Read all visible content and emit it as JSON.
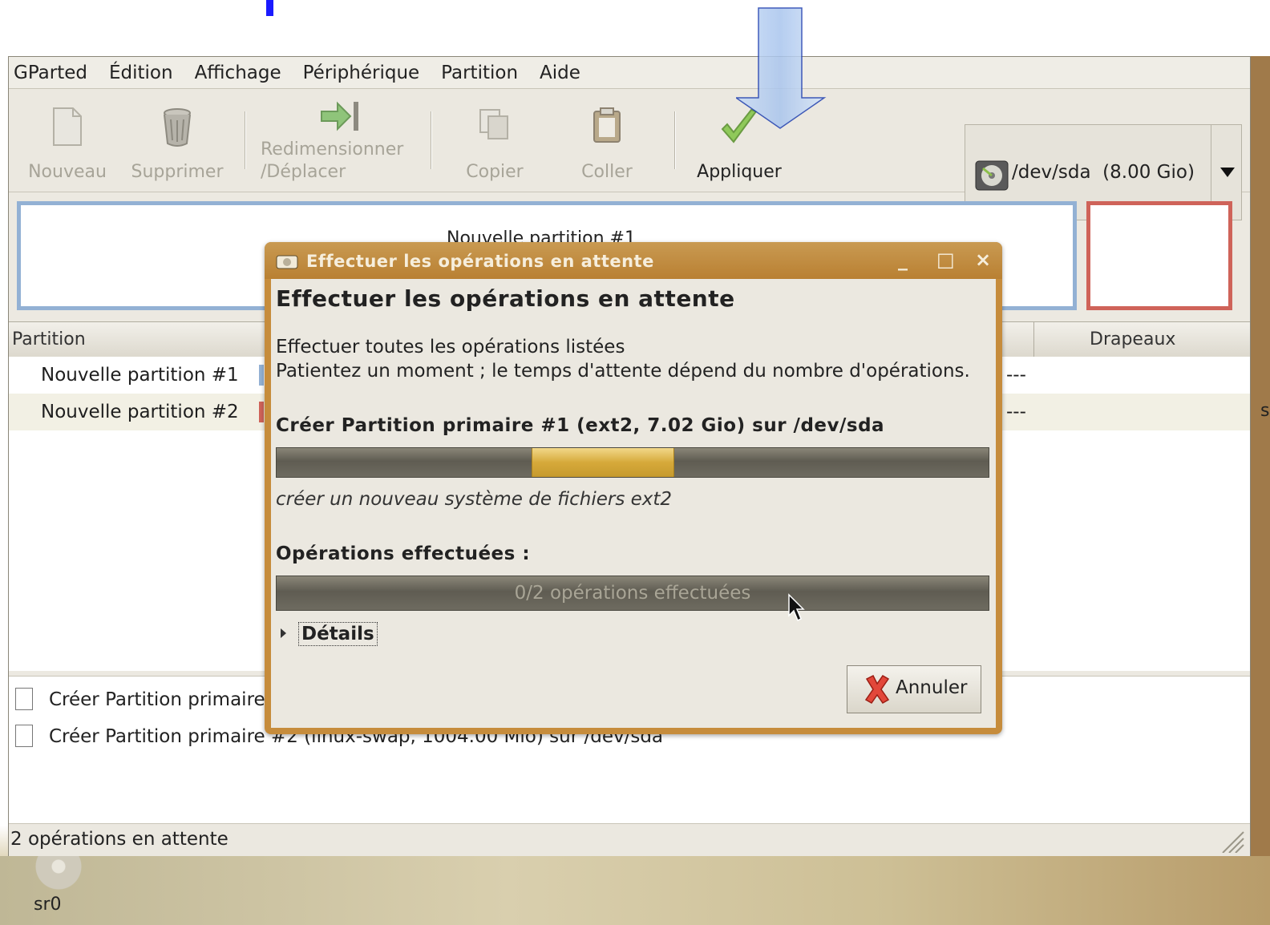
{
  "desktop": {
    "sr0_label": "sr0",
    "edge_char": "s"
  },
  "menubar": {
    "items": [
      {
        "label": "GParted"
      },
      {
        "label": "Édition"
      },
      {
        "label": "Affichage"
      },
      {
        "label": "Périphérique"
      },
      {
        "label": "Partition"
      },
      {
        "label": "Aide"
      }
    ]
  },
  "toolbar": {
    "new_label": "Nouveau",
    "delete_label": "Supprimer",
    "resize_label_1": "Redimensionner",
    "resize_label_2": "/Déplacer",
    "copy_label": "Copier",
    "paste_label": "Coller",
    "apply_label": "Appliquer"
  },
  "device": {
    "label": "/dev/sda  (8.00 Gio)"
  },
  "partition_map": {
    "label": "Nouvelle partition #1"
  },
  "partition_list": {
    "headers": {
      "partition": "Partition",
      "flags": "Drapeaux"
    },
    "rows": [
      {
        "name": "Nouvelle partition #1",
        "flags": "---",
        "color": "#93b1d4"
      },
      {
        "name": "Nouvelle partition #2",
        "flags": "---",
        "color": "#cf6359"
      }
    ]
  },
  "operations": {
    "items": [
      {
        "label": "Créer Partition primaire"
      },
      {
        "label": "Créer Partition primaire #2 (linux-swap, 1004.00 Mio) sur /dev/sda"
      }
    ]
  },
  "statusbar": {
    "text": "2 opérations en attente"
  },
  "dialog": {
    "title": "Effectuer les opérations en attente",
    "heading": "Effectuer les opérations en attente",
    "line1": "Effectuer toutes les opérations listées",
    "line2": "Patientez un moment ; le temps d'attente dépend du nombre d'opérations.",
    "op_title": "Créer Partition primaire #1 (ext2, 7.02 Gio) sur /dev/sda",
    "op_sub": "créer un nouveau système de fichiers ext2",
    "done_title": "Opérations effectuées :",
    "done_progress_text": "0/2 opérations effectuées",
    "done_progress_fraction": 0.0,
    "details_label": "Détails",
    "cancel_label": "Annuler",
    "buttons": {
      "minimize": "_",
      "maximize": "□",
      "close": "×"
    }
  }
}
